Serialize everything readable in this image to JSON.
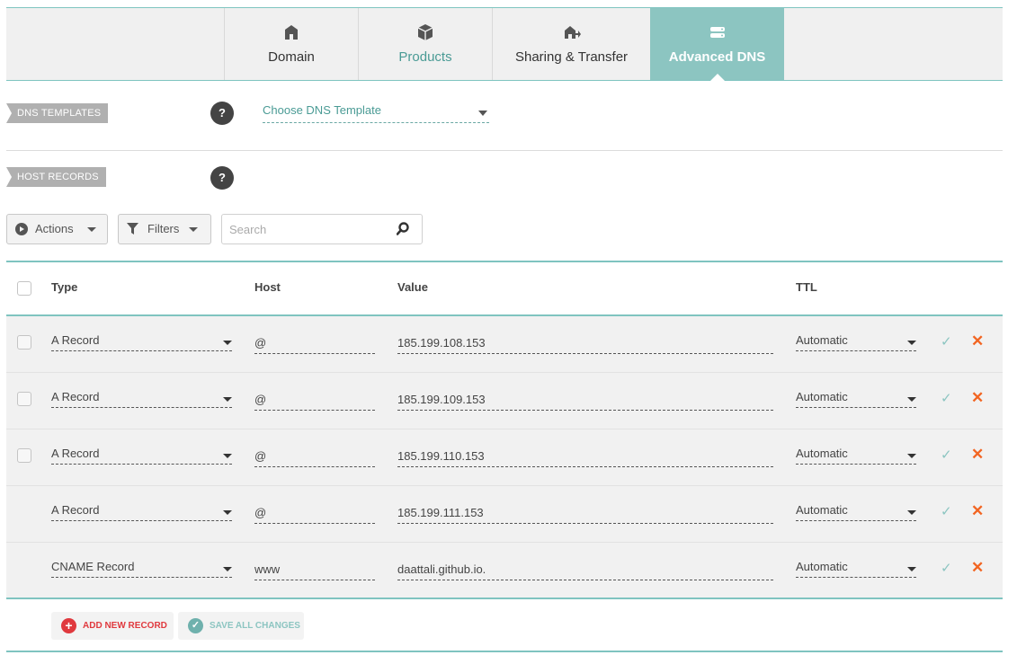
{
  "tabs": [
    {
      "label": "Domain",
      "icon": "home-icon"
    },
    {
      "label": "Products",
      "icon": "box-icon"
    },
    {
      "label": "Sharing & Transfer",
      "icon": "transfer-icon"
    },
    {
      "label": "Advanced DNS",
      "icon": "server-icon",
      "active": true
    }
  ],
  "dns_templates": {
    "tag": "DNS TEMPLATES",
    "help": "?",
    "select_value": "Choose DNS Template"
  },
  "host_records": {
    "tag": "HOST RECORDS",
    "help": "?"
  },
  "toolbar": {
    "actions_label": "Actions",
    "filters_label": "Filters",
    "search_placeholder": "Search"
  },
  "table": {
    "headers": {
      "type": "Type",
      "host": "Host",
      "value": "Value",
      "ttl": "TTL"
    },
    "rows": [
      {
        "type": "A Record",
        "host": "@",
        "value": "185.199.108.153",
        "ttl": "Automatic",
        "checkbox": true
      },
      {
        "type": "A Record",
        "host": "@",
        "value": "185.199.109.153",
        "ttl": "Automatic",
        "checkbox": true
      },
      {
        "type": "A Record",
        "host": "@",
        "value": "185.199.110.153",
        "ttl": "Automatic",
        "checkbox": true
      },
      {
        "type": "A Record",
        "host": "@",
        "value": "185.199.111.153",
        "ttl": "Automatic",
        "checkbox": false
      },
      {
        "type": "CNAME Record",
        "host": "www",
        "value": "daattali.github.io.",
        "ttl": "Automatic",
        "checkbox": false
      }
    ]
  },
  "footer": {
    "add_label": "ADD NEW RECORD",
    "save_label": "SAVE ALL CHANGES"
  },
  "colors": {
    "accent": "#8cc5c1",
    "delete": "#f26522",
    "add": "#e0393e"
  }
}
